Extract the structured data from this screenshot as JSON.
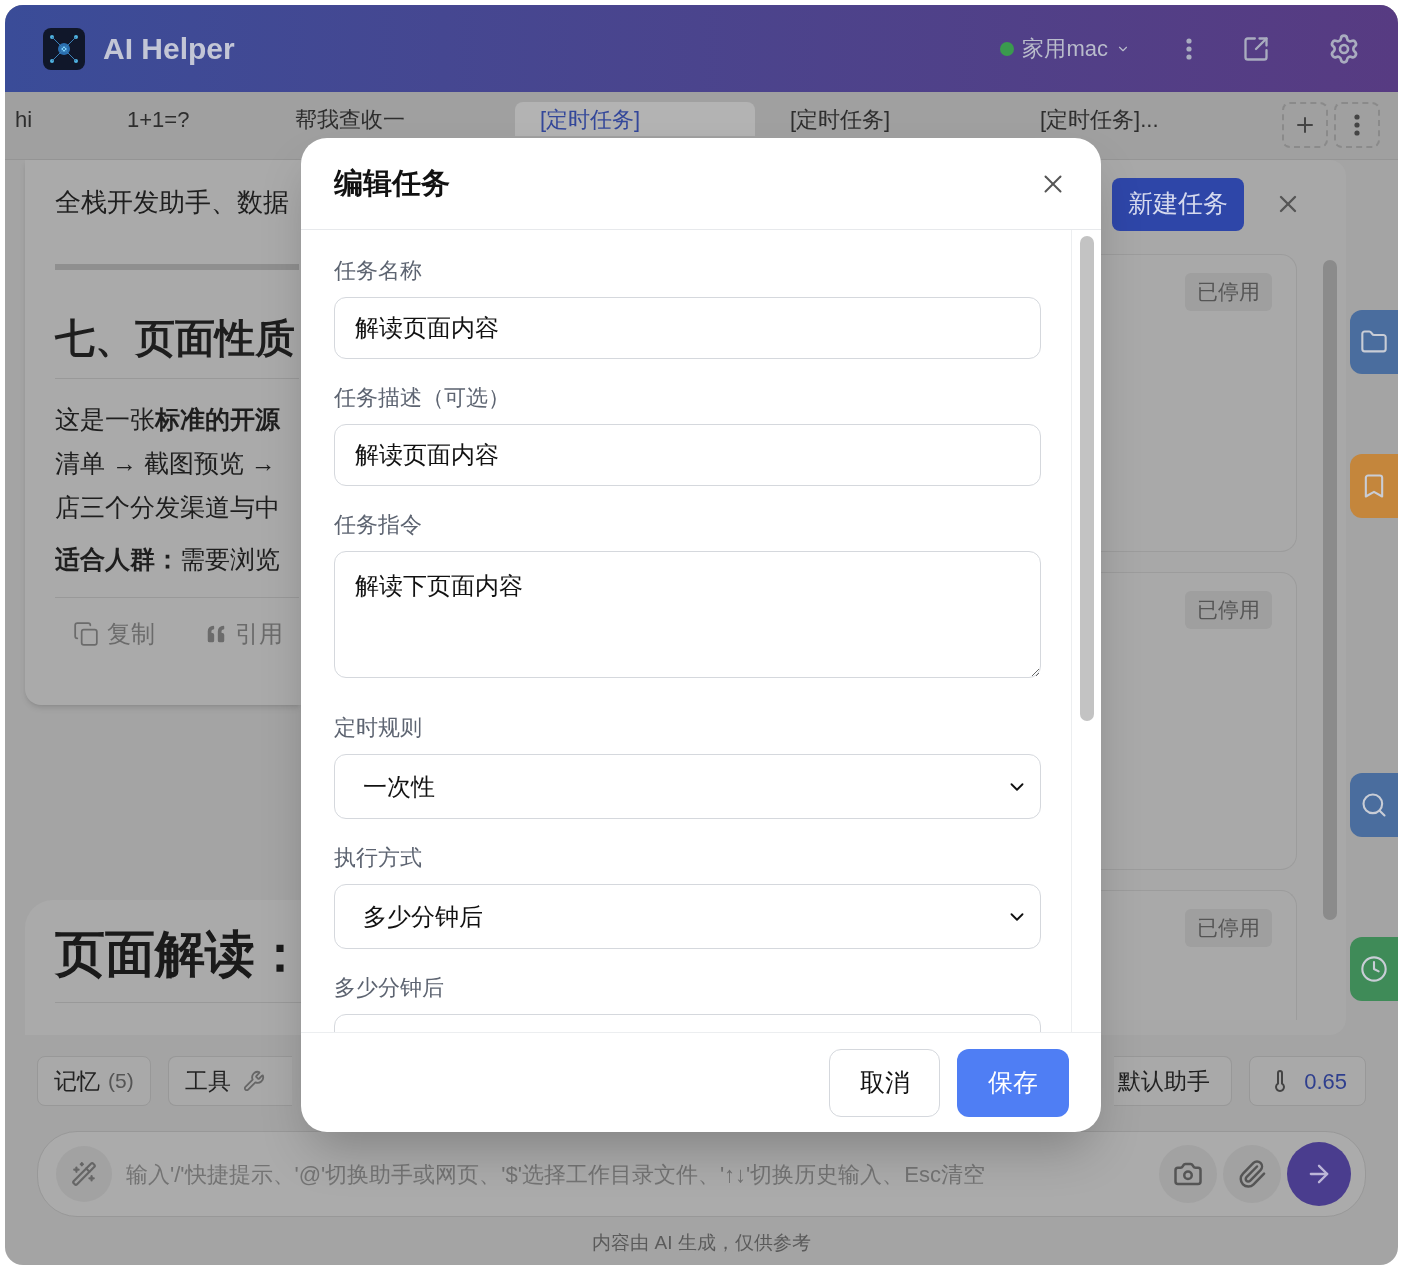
{
  "header": {
    "title": "AI Helper",
    "device": {
      "name": "家用mac",
      "online": true
    }
  },
  "tabs": [
    {
      "label": "hi",
      "selected": false
    },
    {
      "label": "1+1=?",
      "selected": false
    },
    {
      "label": "帮我查收一",
      "selected": false
    },
    {
      "label": "[定时任务]",
      "selected": true
    },
    {
      "label": "[定时任务]",
      "selected": false
    },
    {
      "label": "[定时任务]...",
      "selected": false
    }
  ],
  "chat": {
    "intro": "全栈开发助手、数据",
    "heading": "七、页面性质",
    "paragraph_lines": [
      "这是一张**标准的开源**",
      "清单 → 截图预览 →",
      "店三个分发渠道与中"
    ],
    "audience": {
      "label": "适合人群：",
      "text": "需要浏览"
    },
    "actions": [
      {
        "kind": "copy",
        "label": "复制"
      },
      {
        "kind": "quote",
        "label": "引用"
      }
    ],
    "next_heading": "页面解读："
  },
  "task_panel": {
    "new_button": "新建任务",
    "tasks": [
      {
        "status": "已停用"
      },
      {
        "status": "已停用"
      },
      {
        "status": "已停用"
      }
    ]
  },
  "side_buttons": [
    {
      "kind": "folder",
      "color": "#4a6d9e"
    },
    {
      "kind": "bookmark",
      "color": "#c4863c"
    },
    {
      "kind": "search",
      "color": "#4a6d9e"
    },
    {
      "kind": "clock",
      "color": "#3f8b58"
    }
  ],
  "dialog": {
    "title": "编辑任务",
    "fields": [
      {
        "kind": "text",
        "label": "任务名称",
        "value": "解读页面内容"
      },
      {
        "kind": "text",
        "label": "任务描述（可选）",
        "value": "解读页面内容"
      },
      {
        "kind": "textarea",
        "label": "任务指令",
        "value": "解读下页面内容"
      },
      {
        "kind": "select",
        "label": "定时规则",
        "value": "一次性"
      },
      {
        "kind": "select",
        "label": "执行方式",
        "value": "多少分钟后"
      },
      {
        "kind": "text",
        "label": "多少分钟后"
      }
    ],
    "cancel": "取消",
    "save": "保存"
  },
  "toolbar": {
    "memory": {
      "label": "记忆",
      "count": "(5)"
    },
    "tools": "工具",
    "assistant": "默认助手",
    "temperature": "0.65"
  },
  "input": {
    "placeholder": "输入'/'快捷提示、'@'切换助手或网页、'$'选择工作目录文件、'↑↓'切换历史输入、Esc清空"
  },
  "footer": "内容由 AI 生成，仅供参考"
}
